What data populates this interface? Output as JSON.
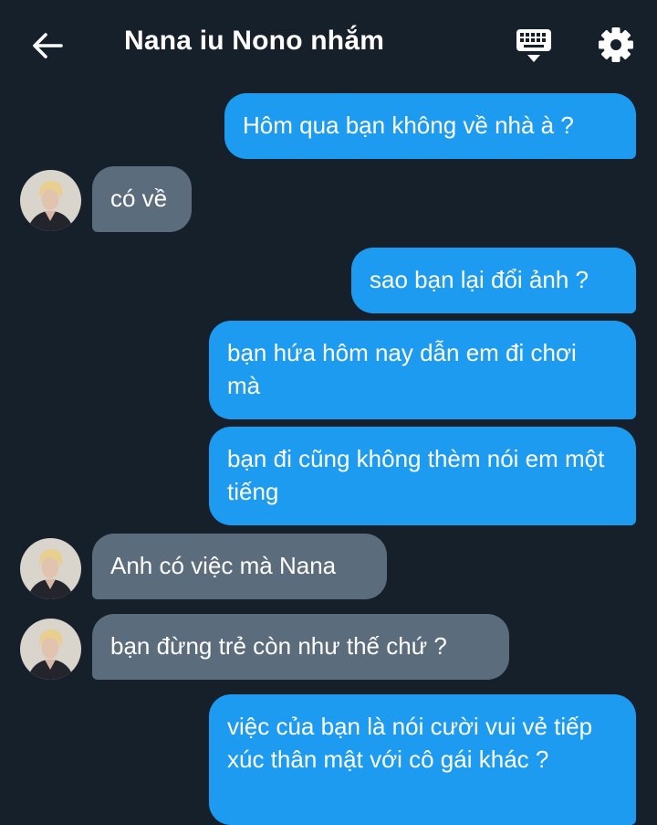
{
  "header": {
    "title": "Nana iu Nono nhắm",
    "back_icon": "arrow-left-icon",
    "keyboard_icon": "keyboard-icon",
    "settings_icon": "gear-icon"
  },
  "colors": {
    "background": "#15202b",
    "outgoing_bubble": "#1d9bf0",
    "incoming_bubble": "#5b6c7d",
    "text": "#ffffff"
  },
  "messages": [
    {
      "direction": "outgoing",
      "text": "Hôm qua bạn không về nhà à ?"
    },
    {
      "direction": "incoming",
      "text": "có về"
    },
    {
      "direction": "outgoing",
      "text": "sao bạn lại đổi ảnh ?"
    },
    {
      "direction": "outgoing",
      "text": "bạn hứa hôm nay dẫn em đi chơi mà"
    },
    {
      "direction": "outgoing",
      "text": "bạn đi cũng không thèm nói em một tiếng"
    },
    {
      "direction": "incoming",
      "text": "Anh có việc mà Nana"
    },
    {
      "direction": "incoming",
      "text": "bạn đừng trẻ còn như thế chứ ?"
    },
    {
      "direction": "outgoing",
      "text": "việc của bạn là nói cười vui vẻ tiếp xúc thân mật với cô gái khác ?"
    }
  ]
}
